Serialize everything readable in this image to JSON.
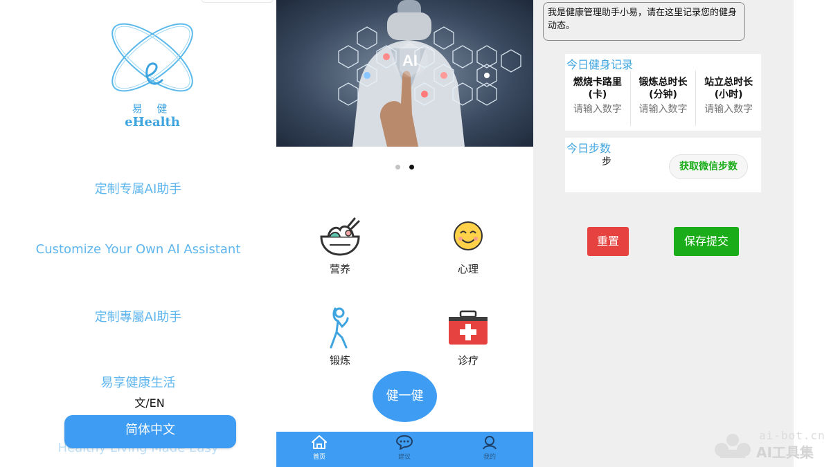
{
  "splash": {
    "logo_cn": "易 健",
    "logo_en": "eHealth",
    "slogans": [
      "定制专属AI助手",
      "Customize Your Own AI Assistant",
      "定制專屬AI助手",
      "易享健康生活",
      "Healthy Living Made Easy"
    ],
    "lang_label": "文/EN",
    "lang_button": "简体中文"
  },
  "home": {
    "banner_text": "AI",
    "carousel": {
      "count": 2,
      "active_index": 1
    },
    "categories": [
      {
        "label": "营养",
        "icon": "nutrition-bowl-icon"
      },
      {
        "label": "心理",
        "icon": "smiley-face-icon"
      },
      {
        "label": "锻炼",
        "icon": "exercise-figure-icon"
      },
      {
        "label": "诊疗",
        "icon": "medical-kit-icon"
      }
    ],
    "fab_label": "健一健",
    "tabs": [
      {
        "label": "首页",
        "icon": "home-icon"
      },
      {
        "label": "建议",
        "icon": "chat-bubble-icon"
      },
      {
        "label": "我的",
        "icon": "user-icon"
      }
    ],
    "colors": {
      "primary": "#3e9df2"
    }
  },
  "record": {
    "assistant_message": "我是健康管理助手小易，请在这里记录您的健身动态。",
    "today_fitness": {
      "title": "今日健身记录",
      "columns": [
        {
          "header_line1": "燃烧卡路里",
          "header_line2": "(卡)",
          "placeholder": "请输入数字"
        },
        {
          "header_line1": "锻炼总时长",
          "header_line2": "(分钟)",
          "placeholder": "请输入数字"
        },
        {
          "header_line1": "站立总时长",
          "header_line2": "(小时)",
          "placeholder": "请输入数字"
        }
      ]
    },
    "today_steps": {
      "title": "今日步数",
      "unit": "步",
      "wechat_button": "获取微信步数"
    },
    "reset_button": "重置",
    "save_button": "保存提交",
    "colors": {
      "title": "#3da4e0",
      "reset": "#e64340",
      "save": "#1aad19"
    }
  },
  "watermark": {
    "url": "ai-bot.cn",
    "name": "AI工具集"
  }
}
